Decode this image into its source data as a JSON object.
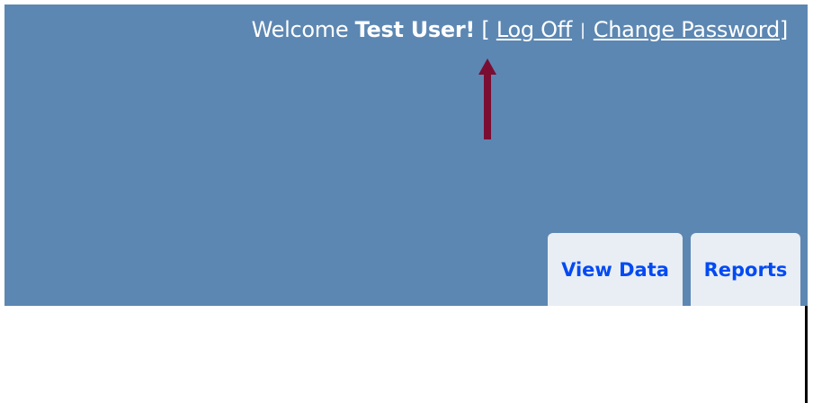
{
  "header": {
    "welcome_prefix": "Welcome ",
    "user_name": "Test User",
    "welcome_suffix": "!",
    "bracket_open": "[",
    "logoff_label": "Log Off",
    "separator": "|",
    "change_password_label": "Change Password",
    "bracket_close": "]"
  },
  "menu": {
    "tabs": [
      {
        "label": "View Data"
      },
      {
        "label": "Reports"
      }
    ]
  },
  "colors": {
    "header_bg": "#5c87b2",
    "tab_bg": "#e8eef4",
    "tab_text": "#034af3",
    "arrow": "#7b0d32"
  },
  "annotation": {
    "icon": "arrow-up-icon"
  }
}
